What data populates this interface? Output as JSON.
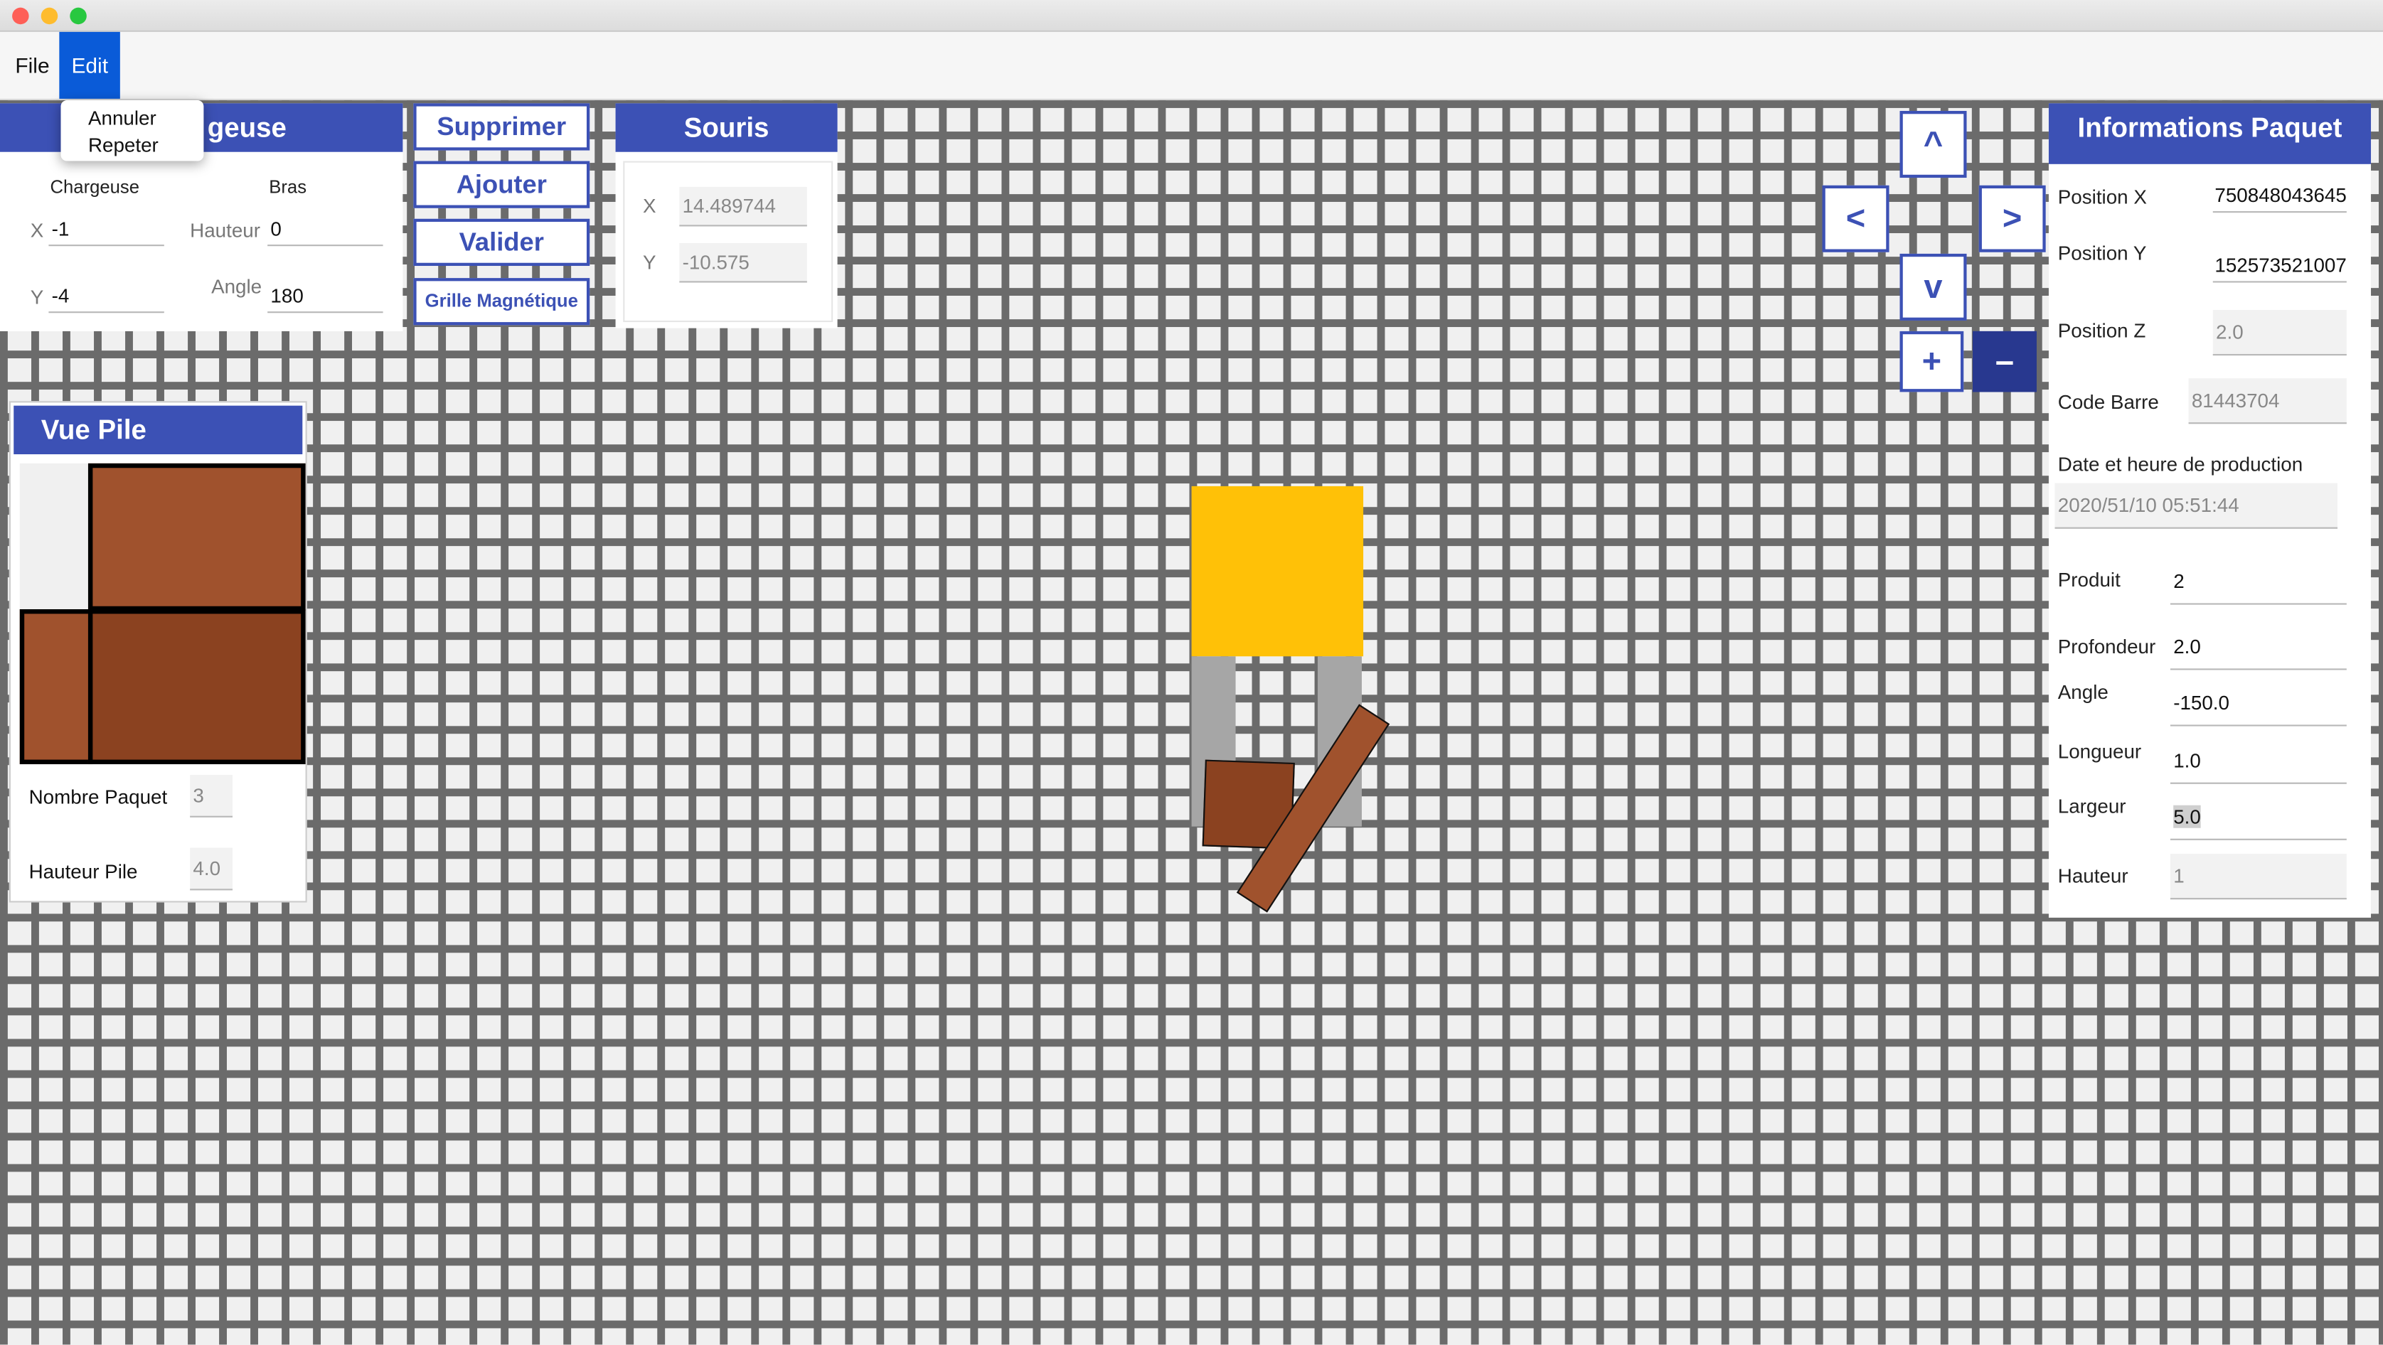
{
  "menubar": {
    "file": "File",
    "edit": "Edit"
  },
  "edit_menu": {
    "undo": "Annuler",
    "redo": "Repeter"
  },
  "chargeuse_panel": {
    "title_visible": "geuse",
    "col_chargeuse": "Chargeuse",
    "col_bras": "Bras",
    "x_label": "X",
    "x_value": "-1",
    "y_label": "Y",
    "y_value": "-4",
    "hauteur_label": "Hauteur",
    "hauteur_value": "0",
    "angle_label": "Angle",
    "angle_value": "180"
  },
  "actions": {
    "supprimer": "Supprimer",
    "ajouter": "Ajouter",
    "valider": "Valider",
    "grille": "Grille Magnétique"
  },
  "souris": {
    "title": "Souris",
    "x_label": "X",
    "x_value": "14.489744",
    "y_label": "Y",
    "y_value": "-10.575"
  },
  "vue_pile": {
    "title": "Vue Pile",
    "nombre_label": "Nombre Paquet",
    "nombre_value": "3",
    "hauteur_label": "Hauteur Pile",
    "hauteur_value": "4.0"
  },
  "nav": {
    "up": "^",
    "left": "<",
    "right": ">",
    "down": "v",
    "zoom_in": "+",
    "zoom_out": "–"
  },
  "info": {
    "title": "Informations Paquet",
    "pos_x_label": "Position X",
    "pos_x_value": "750848043645",
    "pos_y_label": "Position Y",
    "pos_y_value": "152573521007",
    "pos_z_label": "Position Z",
    "pos_z_value": "2.0",
    "code_label": "Code Barre",
    "code_value": "81443704",
    "date_label": "Date et heure de production",
    "date_value": "2020/51/10 05:51:44",
    "produit_label": "Produit",
    "produit_value": "2",
    "profondeur_label": "Profondeur",
    "profondeur_value": "2.0",
    "angle_label": "Angle",
    "angle_value": "-150.0",
    "longueur_label": "Longueur",
    "longueur_value": "1.0",
    "largeur_label": "Largeur",
    "largeur_value": "5.0",
    "hauteur_label": "Hauteur",
    "hauteur_value": "1"
  },
  "colors": {
    "accent": "#3c51b5",
    "grid": "#6b6b6b",
    "chargeuse_body": "#ffc107",
    "arm": "#a6a6a6",
    "package_dark": "#8b4220",
    "package_light": "#a0522d"
  }
}
